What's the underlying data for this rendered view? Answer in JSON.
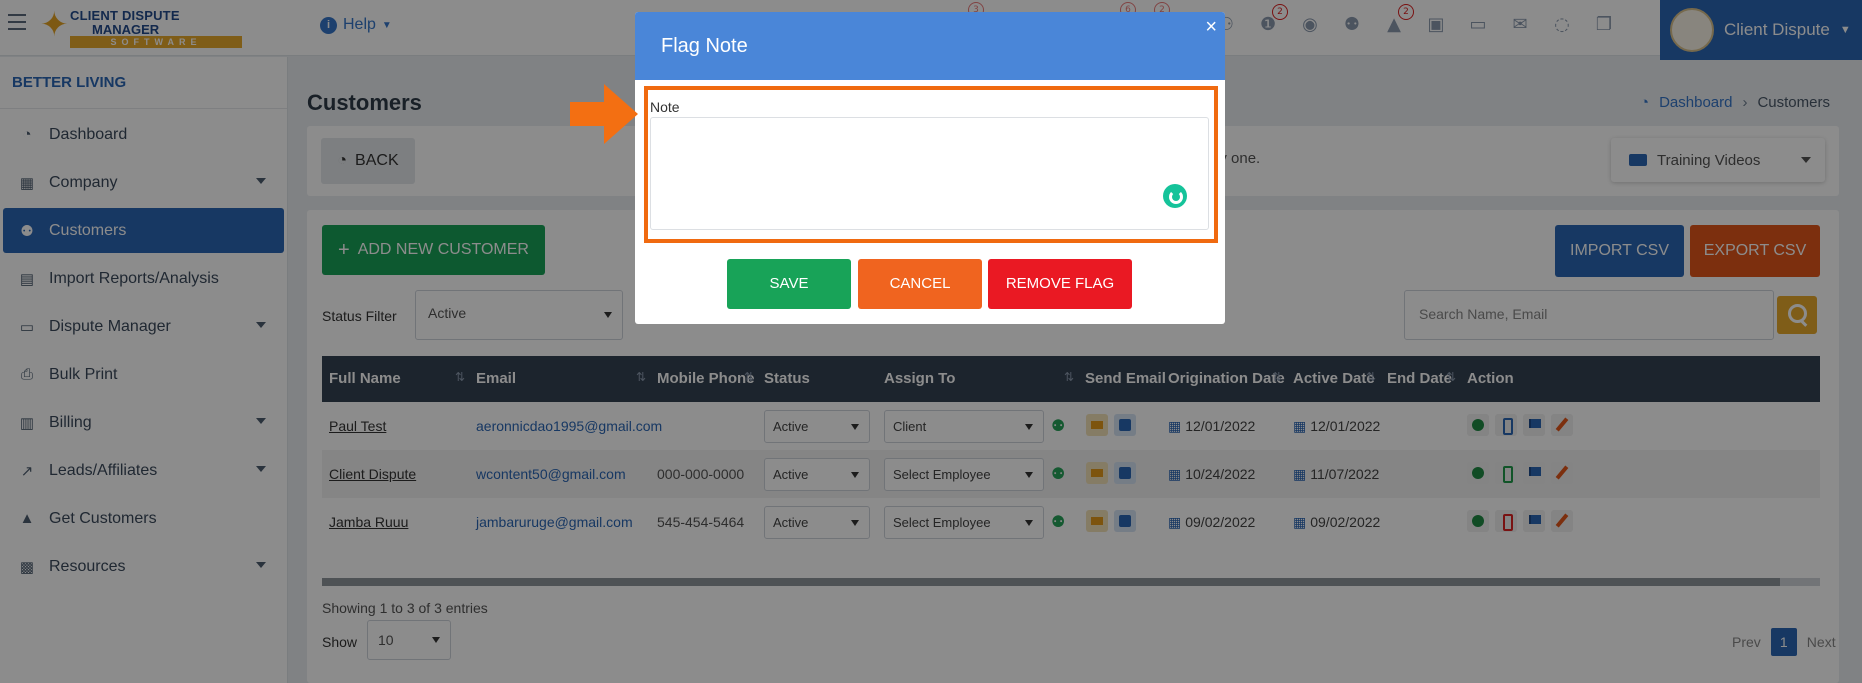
{
  "header": {
    "logo": {
      "line1": "CLIENT DISPUTE",
      "line2": "MANAGER",
      "line3": "SOFTWARE"
    },
    "help_label": "Help",
    "icon_badges": [
      {
        "icon": "group-icon",
        "badge": ""
      },
      {
        "icon": "alert-circle-icon",
        "badge": "2"
      },
      {
        "icon": "user-circle-icon",
        "badge": ""
      },
      {
        "icon": "users-icon",
        "badge": ""
      },
      {
        "icon": "warning-icon",
        "badge": "2"
      },
      {
        "icon": "inbox-icon",
        "badge": ""
      },
      {
        "icon": "money-icon",
        "badge": ""
      },
      {
        "icon": "mail-icon",
        "badge": ""
      },
      {
        "icon": "chat-icon",
        "badge": ""
      },
      {
        "icon": "copy-icon",
        "badge": ""
      }
    ],
    "ghost_badges": [
      "3",
      "6",
      "2"
    ],
    "user_name": "Client Dispute"
  },
  "sidebar": {
    "brand": "BETTER LIVING",
    "items": [
      {
        "label": "Dashboard",
        "icon": "pie-chart-icon",
        "caret": false
      },
      {
        "label": "Company",
        "icon": "building-icon",
        "caret": true
      },
      {
        "label": "Customers",
        "icon": "users-icon",
        "caret": false,
        "active": true
      },
      {
        "label": "Import Reports/Analysis",
        "icon": "file-import-icon",
        "caret": false
      },
      {
        "label": "Dispute Manager",
        "icon": "laptop-icon",
        "caret": true
      },
      {
        "label": "Bulk Print",
        "icon": "printer-icon",
        "caret": false
      },
      {
        "label": "Billing",
        "icon": "invoice-icon",
        "caret": true
      },
      {
        "label": "Leads/Affiliates",
        "icon": "chart-line-icon",
        "caret": true
      },
      {
        "label": "Get Customers",
        "icon": "graduation-cap-icon",
        "caret": false
      },
      {
        "label": "Resources",
        "icon": "briefcase-icon",
        "caret": true
      }
    ]
  },
  "page": {
    "title": "Customers",
    "breadcrumb": {
      "home": "Dashboard",
      "current": "Customers"
    },
    "back_label": "BACK",
    "info_text": "by one.",
    "training_videos_label": "Training Videos",
    "add_customer_label": "ADD NEW CUSTOMER",
    "import_label": "IMPORT CSV",
    "export_label": "EXPORT CSV",
    "status_filter_label": "Status Filter",
    "status_filter_value": "Active",
    "search_placeholder": "Search Name, Email"
  },
  "table": {
    "columns": [
      "Full Name",
      "Email",
      "Mobile Phone",
      "Status",
      "Assign To",
      "Send Email",
      "Origination Date",
      "Active Date",
      "End Date",
      "Action"
    ],
    "rows": [
      {
        "name": "Paul Test",
        "email": "aeronnicdao1995@gmail.com",
        "phone": "",
        "status": "Active",
        "assign": "Client",
        "origination": "12/01/2022",
        "active_date": "12/01/2022",
        "end_date": "",
        "phone_icon": "blue"
      },
      {
        "name": "Client Dispute",
        "email": "wcontent50@gmail.com",
        "phone": "000-000-0000",
        "status": "Active",
        "assign": "Select Employee",
        "origination": "10/24/2022",
        "active_date": "11/07/2022",
        "end_date": "",
        "phone_icon": "green"
      },
      {
        "name": "Jamba Ruuu",
        "email": "jambaruruge@gmail.com",
        "phone": "545-454-5464",
        "status": "Active",
        "assign": "Select Employee",
        "origination": "09/02/2022",
        "active_date": "09/02/2022",
        "end_date": "",
        "phone_icon": "red"
      }
    ],
    "showing_text": "Showing 1 to 3 of 3 entries",
    "show_label": "Show",
    "page_size": "10",
    "pager": {
      "prev": "Prev",
      "current": "1",
      "next": "Next"
    }
  },
  "modal": {
    "title": "Flag Note",
    "close": "×",
    "note_label": "Note",
    "note_value": "",
    "save_label": "SAVE",
    "cancel_label": "CANCEL",
    "remove_label": "REMOVE FLAG"
  },
  "colors": {
    "primary": "#2b66b4",
    "modal_header": "#4a86d8",
    "save": "#18a358",
    "cancel": "#f0641f",
    "remove": "#ea1923",
    "highlight": "#f06a10",
    "export": "#e2561b",
    "accent_gold": "#e8a92c"
  }
}
